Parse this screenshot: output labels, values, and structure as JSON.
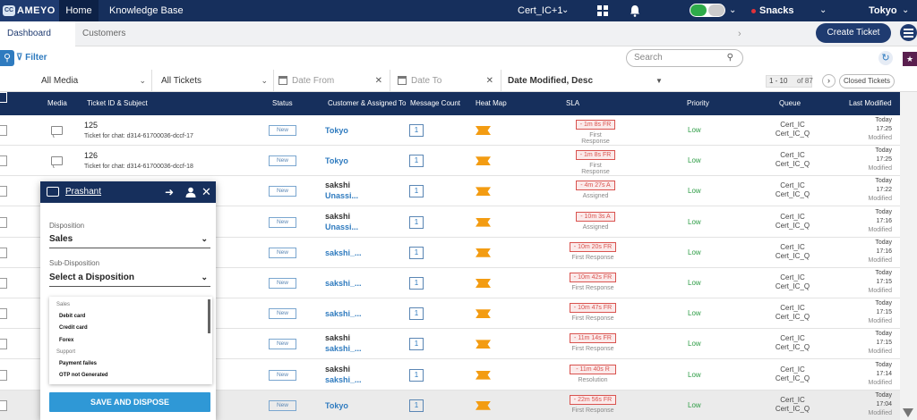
{
  "nav": {
    "logo_mark": "CC",
    "logo_text": "AMEYO",
    "home": "Home",
    "knowledge_base": "Knowledge Base",
    "campaign": "Cert_IC+1",
    "status": "Snacks",
    "user": "Tokyo"
  },
  "tabs": {
    "dashboard": "Dashboard",
    "customers": "Customers",
    "create_ticket": "Create Ticket"
  },
  "filter": {
    "label": "Filter",
    "search_placeholder": "Search"
  },
  "selects": {
    "media": "All Media",
    "tickets": "All Tickets",
    "date_from": "Date From",
    "date_to": "Date To",
    "sort": "Date Modified, Desc",
    "pager_range": "1 - 10",
    "pager_total": "of 87",
    "closed_tickets": "Closed Tickets"
  },
  "table": {
    "headers": [
      "Media",
      "Ticket ID & Subject",
      "Status",
      "Customer & Assigned To",
      "Message Count",
      "Heat Map",
      "SLA",
      "Priority",
      "Queue",
      "Last Modified"
    ],
    "rows": [
      {
        "id": "125",
        "subject": "Ticket for chat: d314-61700036-dccf-17",
        "status": "New",
        "cust1": "Tokyo",
        "cust2": "",
        "cust_dark": false,
        "count": "1",
        "sla": "- 1m 8s FR",
        "sla_sub": "First Response",
        "priority": "Low",
        "queue1": "Cert_IC",
        "queue2": "Cert_IC_Q",
        "day": "Today",
        "time": "17:25",
        "mod": "Modified"
      },
      {
        "id": "126",
        "subject": "Ticket for chat: d314-61700036-dccf-18",
        "status": "New",
        "cust1": "Tokyo",
        "cust2": "",
        "cust_dark": false,
        "count": "1",
        "sla": "- 1m 8s FR",
        "sla_sub": "First Response",
        "priority": "Low",
        "queue1": "Cert_IC",
        "queue2": "Cert_IC_Q",
        "day": "Today",
        "time": "17:25",
        "mod": "Modified"
      },
      {
        "id": "",
        "subject": "",
        "status": "New",
        "cust1": "sakshi",
        "cust2": "Unassi...",
        "cust_dark": true,
        "count": "1",
        "sla": "- 4m 27s A",
        "sla_sub": "Assigned",
        "priority": "Low",
        "queue1": "Cert_IC",
        "queue2": "Cert_IC_Q",
        "day": "Today",
        "time": "17:22",
        "mod": "Modified"
      },
      {
        "id": "",
        "subject": "",
        "status": "New",
        "cust1": "sakshi",
        "cust2": "Unassi...",
        "cust_dark": true,
        "count": "1",
        "sla": "- 10m 3s A",
        "sla_sub": "Assigned",
        "priority": "Low",
        "queue1": "Cert_IC",
        "queue2": "Cert_IC_Q",
        "day": "Today",
        "time": "17:16",
        "mod": "Modified"
      },
      {
        "id": "",
        "subject": "",
        "status": "New",
        "cust1": "sakshi_...",
        "cust2": "",
        "cust_dark": false,
        "count": "1",
        "sla": "- 10m 20s FR",
        "sla_sub": "First Response",
        "priority": "Low",
        "queue1": "Cert_IC",
        "queue2": "Cert_IC_Q",
        "day": "Today",
        "time": "17:16",
        "mod": "Modified"
      },
      {
        "id": "",
        "subject": "",
        "status": "New",
        "cust1": "sakshi_...",
        "cust2": "",
        "cust_dark": false,
        "count": "1",
        "sla": "- 10m 42s FR",
        "sla_sub": "First Response",
        "priority": "Low",
        "queue1": "Cert_IC",
        "queue2": "Cert_IC_Q",
        "day": "Today",
        "time": "17:15",
        "mod": "Modified"
      },
      {
        "id": "",
        "subject": "",
        "status": "New",
        "cust1": "sakshi_...",
        "cust2": "",
        "cust_dark": false,
        "count": "1",
        "sla": "- 10m 47s FR",
        "sla_sub": "First Response",
        "priority": "Low",
        "queue1": "Cert_IC",
        "queue2": "Cert_IC_Q",
        "day": "Today",
        "time": "17:15",
        "mod": "Modified"
      },
      {
        "id": "",
        "subject": "",
        "status": "New",
        "cust1": "sakshi",
        "cust2": "sakshi_...",
        "cust_dark": true,
        "count": "1",
        "sla": "- 11m 14s FR",
        "sla_sub": "First Response",
        "priority": "Low",
        "queue1": "Cert_IC",
        "queue2": "Cert_IC_Q",
        "day": "Today",
        "time": "17:15",
        "mod": "Modified"
      },
      {
        "id": "",
        "subject": "",
        "status": "New",
        "cust1": "sakshi",
        "cust2": "sakshi_...",
        "cust_dark": true,
        "count": "1",
        "sla": "- 11m 40s R",
        "sla_sub": "Resolution",
        "priority": "Low",
        "queue1": "Cert_IC",
        "queue2": "Cert_IC_Q",
        "day": "Today",
        "time": "17:14",
        "mod": "Modified"
      },
      {
        "id": "",
        "subject": "",
        "status": "New",
        "cust1": "Tokyo",
        "cust2": "",
        "cust_dark": false,
        "count": "1",
        "sla": "- 22m 56s FR",
        "sla_sub": "First Response",
        "priority": "Low",
        "queue1": "Cert_IC",
        "queue2": "Cert_IC_Q",
        "day": "Today",
        "time": "17:04",
        "mod": "Modified"
      }
    ]
  },
  "popup": {
    "name": "Prashant",
    "disposition_label": "Disposition",
    "disposition_value": "Sales",
    "subdisposition_label": "Sub-Disposition",
    "subdisposition_value": "Select a Disposition",
    "options": [
      {
        "type": "group",
        "label": "Sales"
      },
      {
        "type": "option",
        "label": "Debit card"
      },
      {
        "type": "option",
        "label": "Credit card"
      },
      {
        "type": "option",
        "label": "Forex"
      },
      {
        "type": "group",
        "label": "Support"
      },
      {
        "type": "option",
        "label": "Payment failes"
      },
      {
        "type": "option",
        "label": "OTP not Generated"
      }
    ],
    "save_label": "SAVE AND DISPOSE"
  },
  "colors": {
    "nav": "#162f5c",
    "accent": "#2f7bbf",
    "sla_red": "#d9534f",
    "priority_green": "#2e9d46",
    "heat": "#f39c12",
    "save_button": "#2f98d6"
  }
}
